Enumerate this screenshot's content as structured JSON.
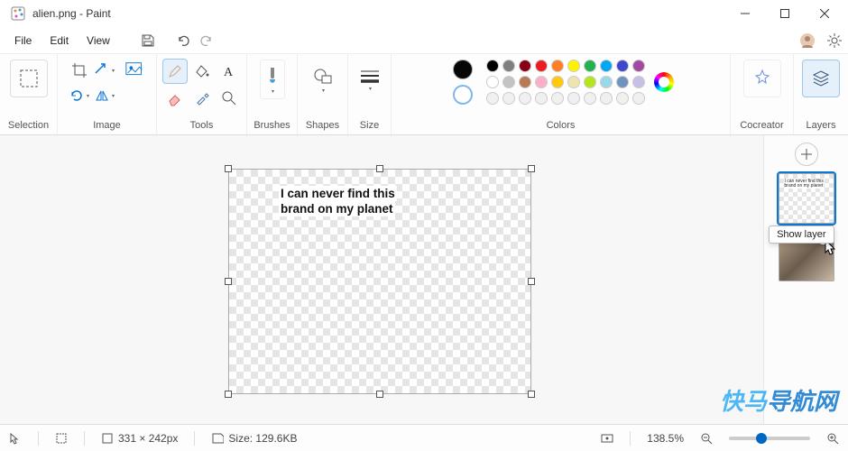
{
  "title": "alien.png - Paint",
  "menu": {
    "file": "File",
    "edit": "Edit",
    "view": "View"
  },
  "ribbon": {
    "selection": "Selection",
    "image": "Image",
    "tools": "Tools",
    "brushes": "Brushes",
    "shapes": "Shapes",
    "size": "Size",
    "colors": "Colors",
    "cocreator": "Cocreator",
    "layers": "Layers"
  },
  "palette": {
    "row1": [
      "#000000",
      "#7f7f7f",
      "#870014",
      "#ec1c23",
      "#ff7e26",
      "#fef200",
      "#23b14d",
      "#00a8f3",
      "#3f47cc",
      "#a349a3"
    ],
    "row2": [
      "#ffffff",
      "#c3c3c3",
      "#b87957",
      "#fdaec9",
      "#ffc90d",
      "#efe3af",
      "#b5e51d",
      "#9ad9ea",
      "#7092bf",
      "#c7bfe5"
    ],
    "row3": [
      "#f0f0f0",
      "#f0f0f0",
      "#f0f0f0",
      "#f0f0f0",
      "#f0f0f0",
      "#f0f0f0",
      "#f0f0f0",
      "#f0f0f0",
      "#f0f0f0",
      "#f0f0f0"
    ]
  },
  "canvas": {
    "text_line1": "I can never find this",
    "text_line2": "brand on my planet"
  },
  "layers_panel": {
    "tooltip": "Show layer"
  },
  "status": {
    "pointer": "",
    "dimensions": "331 × 242px",
    "filesize": "Size: 129.6KB",
    "zoom": "138.5%"
  },
  "watermark_a": "快马",
  "watermark_b": "导航网"
}
